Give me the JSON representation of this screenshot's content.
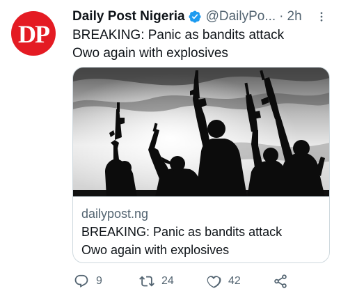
{
  "tweet": {
    "avatar_text": "DP",
    "display_name": "Daily Post Nigeria",
    "handle": "@DailyPo...",
    "separator": "·",
    "time": "2h",
    "text_line1": "BREAKING: Panic as bandits attack",
    "text_line2": "Owo again with explosives"
  },
  "card": {
    "domain": "dailypost.ng",
    "title_line1": "BREAKING: Panic as bandits attack",
    "title_line2": "Owo again with explosives"
  },
  "actions": {
    "reply_count": "9",
    "retweet_count": "24",
    "like_count": "42"
  },
  "colors": {
    "brand_red": "#e41b23",
    "verified_blue": "#1d9bf0",
    "muted_text": "#536471",
    "border": "#cfd9de"
  },
  "icons": [
    "verified-badge-icon",
    "more-icon",
    "reply-icon",
    "retweet-icon",
    "like-icon",
    "share-icon"
  ]
}
